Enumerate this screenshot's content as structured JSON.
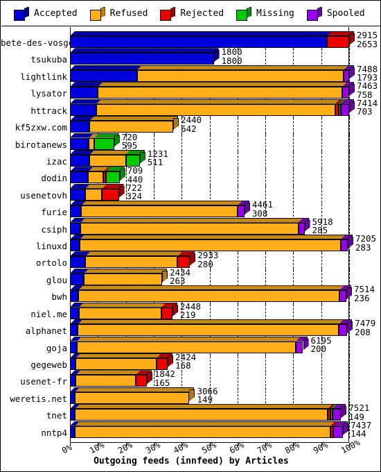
{
  "chart_data": {
    "type": "bar",
    "orientation": "horizontal-stacked",
    "title": "",
    "xlabel": "Outgoing feeds (innfeed) by Articles",
    "ylabel": "",
    "xlim": [
      0,
      100
    ],
    "xticks": [
      "0%",
      "10%",
      "20%",
      "30%",
      "40%",
      "50%",
      "60%",
      "70%",
      "80%",
      "90%",
      "100%"
    ],
    "grid": true,
    "legend_position": "top",
    "series": [
      {
        "name": "Accepted",
        "color": "#0000dd"
      },
      {
        "name": "Refused",
        "color": "#ffae1a"
      },
      {
        "name": "Rejected",
        "color": "#ee0000"
      },
      {
        "name": "Missing",
        "color": "#00cc00"
      },
      {
        "name": "Spooled",
        "color": "#9900ee"
      }
    ],
    "categories": [
      "bete-des-vosges",
      "tsukuba",
      "lightlink",
      "lysator",
      "httrack",
      "kf5zxw.com",
      "birotanews",
      "izac",
      "dodin",
      "usenetovh",
      "furie",
      "csiph",
      "linuxd",
      "ortolo",
      "glou",
      "bwh",
      "niel.me",
      "alphanet",
      "goja",
      "gegeweb",
      "usenet-fr",
      "weretis.net",
      "tnet",
      "nntp4"
    ],
    "rows": [
      {
        "label": "bete-des-vosges",
        "accepted": 92.0,
        "refused": 0.0,
        "rejected": 8.0,
        "missing": 0.0,
        "spooled": 0.0,
        "v1": "2915",
        "v2": "2653"
      },
      {
        "label": "tsukuba",
        "accepted": 51.5,
        "refused": 0.0,
        "rejected": 0.0,
        "missing": 0.0,
        "spooled": 0.0,
        "v1": "1800",
        "v2": "1800"
      },
      {
        "label": "lightlink",
        "accepted": 24.0,
        "refused": 74.0,
        "rejected": 0.0,
        "missing": 0.0,
        "spooled": 2.0,
        "v1": "7488",
        "v2": "1793"
      },
      {
        "label": "lysator",
        "accepted": 10.0,
        "refused": 87.5,
        "rejected": 0.0,
        "missing": 0.0,
        "spooled": 2.5,
        "v1": "7463",
        "v2": "758"
      },
      {
        "label": "httrack",
        "accepted": 9.5,
        "refused": 85.5,
        "rejected": 1.2,
        "missing": 0.8,
        "spooled": 3.0,
        "v1": "7414",
        "v2": "703"
      },
      {
        "label": "kf5zxw.com",
        "accepted": 7.0,
        "refused": 30.0,
        "rejected": 0.0,
        "missing": 0.0,
        "spooled": 0.0,
        "v1": "2440",
        "v2": "642"
      },
      {
        "label": "birotanews",
        "accepted": 6.8,
        "refused": 2.0,
        "rejected": 0.0,
        "missing": 7.0,
        "spooled": 0.0,
        "v1": "720",
        "v2": "595"
      },
      {
        "label": "izac",
        "accepted": 7.0,
        "refused": 13.0,
        "rejected": 0.0,
        "missing": 5.0,
        "spooled": 0.0,
        "v1": "1231",
        "v2": "511"
      },
      {
        "label": "dodin",
        "accepted": 6.5,
        "refused": 5.5,
        "rejected": 0.8,
        "missing": 5.0,
        "spooled": 0.0,
        "v1": "709",
        "v2": "440"
      },
      {
        "label": "usenetovh",
        "accepted": 5.5,
        "refused": 6.0,
        "rejected": 6.0,
        "missing": 0.0,
        "spooled": 0.0,
        "v1": "722",
        "v2": "324"
      },
      {
        "label": "furie",
        "accepted": 4.0,
        "refused": 56.0,
        "rejected": 0.0,
        "missing": 0.0,
        "spooled": 2.5,
        "v1": "4461",
        "v2": "308"
      },
      {
        "label": "csiph",
        "accepted": 3.8,
        "refused": 78.0,
        "rejected": 0.0,
        "missing": 0.0,
        "spooled": 2.2,
        "v1": "5918",
        "v2": "285"
      },
      {
        "label": "linuxd",
        "accepted": 3.5,
        "refused": 93.5,
        "rejected": 0.0,
        "missing": 0.0,
        "spooled": 2.5,
        "v1": "7205",
        "v2": "283"
      },
      {
        "label": "ortolo",
        "accepted": 5.5,
        "refused": 33.0,
        "rejected": 4.5,
        "missing": 0.0,
        "spooled": 0.0,
        "v1": "2933",
        "v2": "280"
      },
      {
        "label": "glou",
        "accepted": 5.0,
        "refused": 28.0,
        "rejected": 0.0,
        "missing": 0.0,
        "spooled": 0.0,
        "v1": "2434",
        "v2": "263"
      },
      {
        "label": "bwh",
        "accepted": 3.0,
        "refused": 93.5,
        "rejected": 0.0,
        "missing": 0.0,
        "spooled": 2.5,
        "v1": "7514",
        "v2": "236"
      },
      {
        "label": "niel.me",
        "accepted": 3.2,
        "refused": 29.5,
        "rejected": 4.0,
        "missing": 0.0,
        "spooled": 0.0,
        "v1": "2448",
        "v2": "219"
      },
      {
        "label": "alphanet",
        "accepted": 2.8,
        "refused": 93.5,
        "rejected": 0.0,
        "missing": 0.0,
        "spooled": 3.0,
        "v1": "7479",
        "v2": "208"
      },
      {
        "label": "goja",
        "accepted": 2.5,
        "refused": 78.5,
        "rejected": 0.0,
        "missing": 0.0,
        "spooled": 2.5,
        "v1": "6195",
        "v2": "200"
      },
      {
        "label": "gegeweb",
        "accepted": 2.0,
        "refused": 29.0,
        "rejected": 4.0,
        "missing": 0.0,
        "spooled": 0.0,
        "v1": "2424",
        "v2": "168"
      },
      {
        "label": "usenet-fr",
        "accepted": 2.0,
        "refused": 21.5,
        "rejected": 4.0,
        "missing": 0.0,
        "spooled": 0.0,
        "v1": "1842",
        "v2": "165"
      },
      {
        "label": "weretis.net",
        "accepted": 1.8,
        "refused": 41.0,
        "rejected": 0.0,
        "missing": 0.0,
        "spooled": 0.0,
        "v1": "3066",
        "v2": "149"
      },
      {
        "label": "tnet",
        "accepted": 1.8,
        "refused": 90.5,
        "rejected": 1.0,
        "missing": 0.8,
        "spooled": 3.0,
        "v1": "7521",
        "v2": "149"
      },
      {
        "label": "nntp4",
        "accepted": 1.8,
        "refused": 91.5,
        "rejected": 1.0,
        "missing": 0.0,
        "spooled": 3.5,
        "v1": "7437",
        "v2": "144"
      }
    ]
  },
  "legend": {
    "items": [
      {
        "label": "Accepted",
        "color": "#0000dd",
        "side": "#000099"
      },
      {
        "label": "Refused",
        "color": "#ffae1a",
        "side": "#c07f00"
      },
      {
        "label": "Rejected",
        "color": "#ee0000",
        "side": "#a50000"
      },
      {
        "label": "Missing",
        "color": "#00cc00",
        "side": "#009400"
      },
      {
        "label": "Spooled",
        "color": "#9900ee",
        "side": "#6b00a5"
      }
    ]
  }
}
